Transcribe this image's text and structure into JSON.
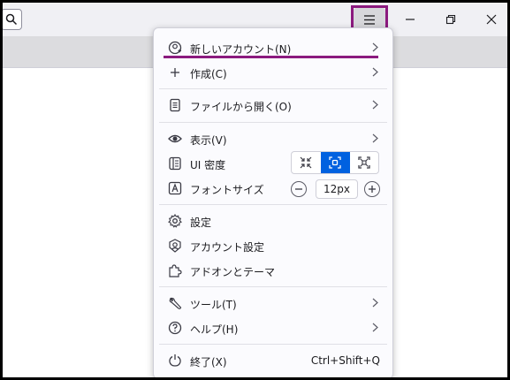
{
  "menu": {
    "items": [
      {
        "label": "新しいアカウント(N)"
      },
      {
        "label": "作成(C)"
      },
      {
        "label": "ファイルから開く(O)"
      },
      {
        "label": "表示(V)"
      },
      {
        "label": "UI 密度"
      },
      {
        "label": "フォントサイズ"
      },
      {
        "label": "設定"
      },
      {
        "label": "アカウント設定"
      },
      {
        "label": "アドオンとテーマ"
      },
      {
        "label": "ツール(T)"
      },
      {
        "label": "ヘルプ(H)"
      },
      {
        "label": "終了(X)",
        "shortcut": "Ctrl+Shift+Q"
      }
    ],
    "font_size": "12px"
  },
  "colors": {
    "accent": "#0061e0",
    "highlight": "#8b1a7e"
  }
}
